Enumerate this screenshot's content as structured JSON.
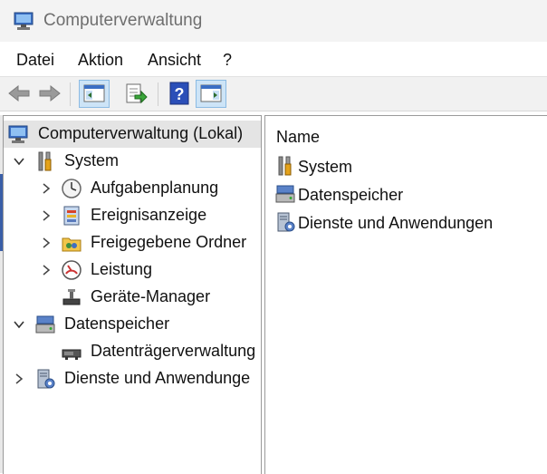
{
  "window": {
    "title": "Computerverwaltung"
  },
  "menu": {
    "items": [
      "Datei",
      "Aktion",
      "Ansicht",
      "?"
    ]
  },
  "tree": {
    "root": "Computerverwaltung (Lokal)",
    "system": "System",
    "aufgaben": "Aufgabenplanung",
    "ereignis": "Ereignisanzeige",
    "freigabe": "Freigegebene Ordner",
    "leistung": "Leistung",
    "geraete": "Geräte-Manager",
    "datenspeicher": "Datenspeicher",
    "datentraeger": "Datenträgerverwaltung",
    "dienste": "Dienste und Anwendunge"
  },
  "content": {
    "column_header": "Name",
    "items": [
      "System",
      "Datenspeicher",
      "Dienste und Anwendungen"
    ]
  },
  "colors": {
    "accent": "#3a5fa8",
    "selection": "#e4e4e4",
    "toolbar_bg": "#f1f1f1"
  }
}
